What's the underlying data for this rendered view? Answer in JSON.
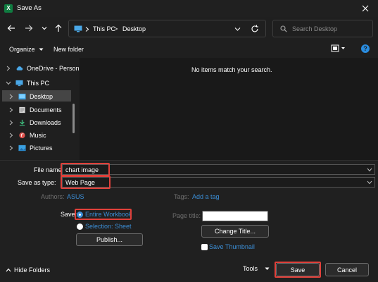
{
  "window": {
    "title": "Save As",
    "app_icon_letter": "X"
  },
  "address": {
    "this_pc": "This PC",
    "folder": "Desktop",
    "sep": ">"
  },
  "search": {
    "placeholder": "Search Desktop"
  },
  "commands": {
    "organize": "Organize",
    "new_folder": "New folder",
    "help": "?"
  },
  "nav_tree": [
    {
      "label": "OneDrive - Person",
      "icon": "cloud-icon",
      "expanded": false
    },
    {
      "label": "This PC",
      "icon": "pc-icon",
      "expanded": true
    },
    {
      "label": "Desktop",
      "icon": "desktop-folder-icon",
      "expanded": false,
      "selected": true
    },
    {
      "label": "Documents",
      "icon": "documents-icon",
      "expanded": false
    },
    {
      "label": "Downloads",
      "icon": "downloads-icon",
      "expanded": false
    },
    {
      "label": "Music",
      "icon": "music-icon",
      "expanded": false
    },
    {
      "label": "Pictures",
      "icon": "pictures-icon",
      "expanded": false
    }
  ],
  "content": {
    "empty_message": "No items match your search."
  },
  "form": {
    "file_name_label": "File name:",
    "file_name_value": "chart image",
    "save_type_label": "Save as type:",
    "save_type_value": "Web Page",
    "authors_label": "Authors:",
    "authors_value": "ASUS",
    "tags_label": "Tags:",
    "tags_value": "Add a tag",
    "save_label": "Save:",
    "radio_entire": "Entire Workbook",
    "radio_selection": "Selection: Sheet",
    "publish_button": "Publish...",
    "page_title_label": "Page title:",
    "page_title_value": "",
    "change_title_button": "Change Title...",
    "save_thumbnail": "Save Thumbnail"
  },
  "footer": {
    "hide_folders": "Hide Folders",
    "tools": "Tools",
    "save_button": "Save",
    "cancel_button": "Cancel"
  },
  "colors": {
    "accent": "#3b8ed6",
    "highlight_box": "#e0403a",
    "background": "#1f1f1f"
  }
}
